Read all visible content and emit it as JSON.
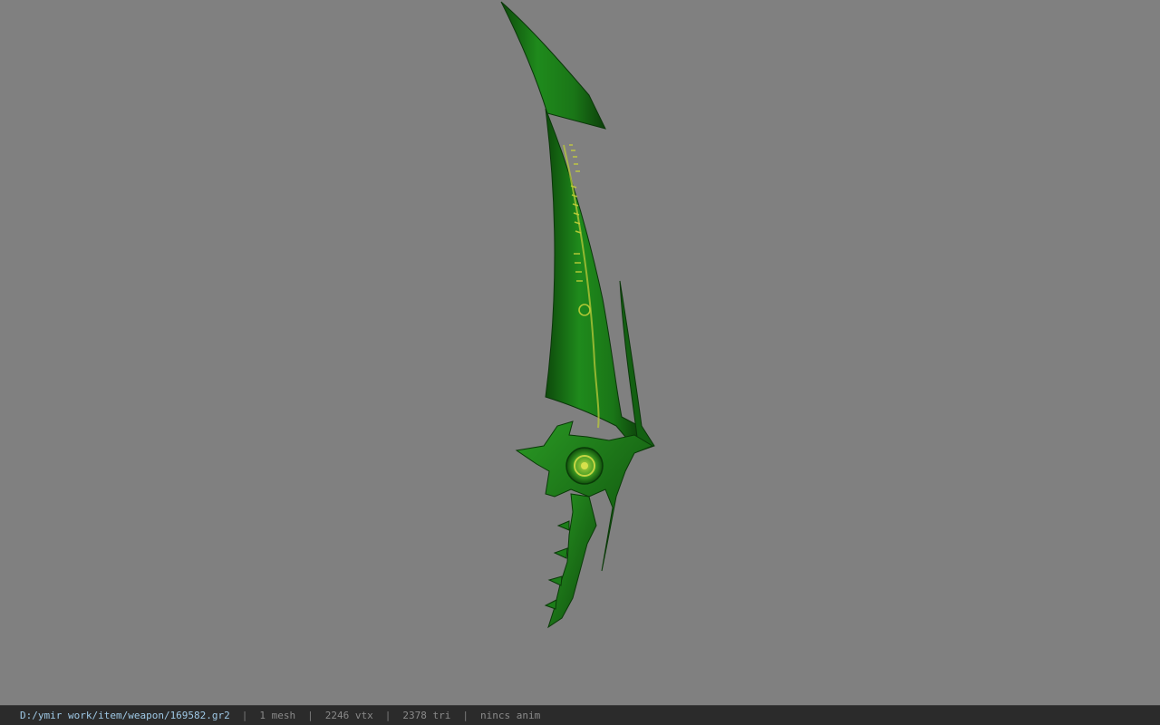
{
  "viewport": {
    "background": "#808080",
    "model": {
      "name": "curved-green-sword",
      "blade_color": "#1e7a1a",
      "blade_dark": "#0f4a0c",
      "rune_color": "#c8d23a"
    }
  },
  "status_bar": {
    "file_path": "D:/ymir work/item/weapon/169582.gr2",
    "separator": "|",
    "mesh_count": "1 mesh",
    "vertex_count": "2246 vtx",
    "triangle_count": "2378 tri",
    "anim_status": "nincs anim"
  }
}
